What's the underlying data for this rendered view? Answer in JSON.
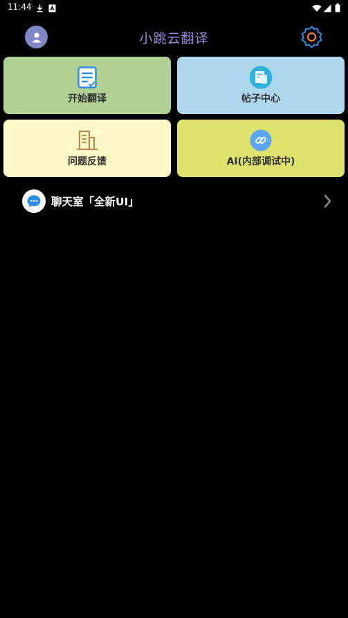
{
  "status_bar": {
    "time": "11:44",
    "icons": [
      "download-icon",
      "notification-a-icon",
      "wifi-icon",
      "cell-signal-icon",
      "battery-icon"
    ]
  },
  "header": {
    "title": "小跳云翻译",
    "avatar_icon": "user-icon",
    "settings_icon": "gear-icon"
  },
  "tiles": [
    {
      "label": "开始翻译",
      "icon": "document-edit-icon",
      "bg": "#b1d192"
    },
    {
      "label": "帖子中心",
      "icon": "posts-icon",
      "bg": "#acd7ed"
    },
    {
      "label": "问题反馈",
      "icon": "building-icon",
      "bg": "#fff9c7"
    },
    {
      "label": "AI(内部调试中)",
      "icon": "link-icon",
      "bg": "#dfe26b"
    }
  ],
  "chat": {
    "label": "聊天室「全新UI」",
    "icon": "chat-bubble-icon",
    "chevron": "chevron-right-icon"
  },
  "colors": {
    "background": "#000000",
    "title": "#9a8fe0",
    "accent_blue": "#2f8de4",
    "accent_orange": "#f2803a"
  }
}
